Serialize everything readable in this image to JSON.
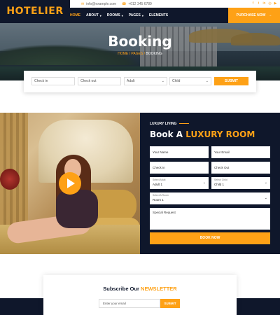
{
  "brand": "HOTELIER",
  "topbar": {
    "email": "info@example.com",
    "phone": "+012 345 6789",
    "socials": [
      "facebook-icon",
      "twitter-icon",
      "linkedin-icon",
      "instagram-icon",
      "youtube-icon"
    ]
  },
  "nav": {
    "items": [
      "HOME",
      "ABOUT",
      "ROOMS",
      "PAGES",
      "ELEMENTS"
    ],
    "purchase": "PURCHASE NOW"
  },
  "hero": {
    "title": "Booking",
    "crumb_home": "HOME",
    "crumb_pages": "PAGES",
    "crumb_current": "BOOKING"
  },
  "booking": {
    "checkin": "Check in",
    "checkout": "Check out",
    "adult": "Adult",
    "child": "Child",
    "submit": "SUBMIT"
  },
  "luxury": {
    "eyebrow": "LUXURY LIVING",
    "title_prefix": "Book A ",
    "title_highlight": "LUXURY ROOM",
    "name_placeholder": "Your Name",
    "email_placeholder": "Your Email",
    "checkin_placeholder": "Check In",
    "checkout_placeholder": "Check Out",
    "adult_label": "Select Adult",
    "adult_value": "Adult 1",
    "child_label": "Select Child",
    "child_value": "Child 1",
    "room_label": "Select A Room",
    "room_value": "Room 1",
    "request_placeholder": "Special Request",
    "book_button": "BOOK NOW"
  },
  "newsletter": {
    "title_prefix": "Subscribe Our ",
    "title_highlight": "NEWSLETTER",
    "placeholder": "Enter your email",
    "submit": "SUBMIT"
  },
  "colors": {
    "primary": "#fea116",
    "dark": "#0f172b"
  }
}
